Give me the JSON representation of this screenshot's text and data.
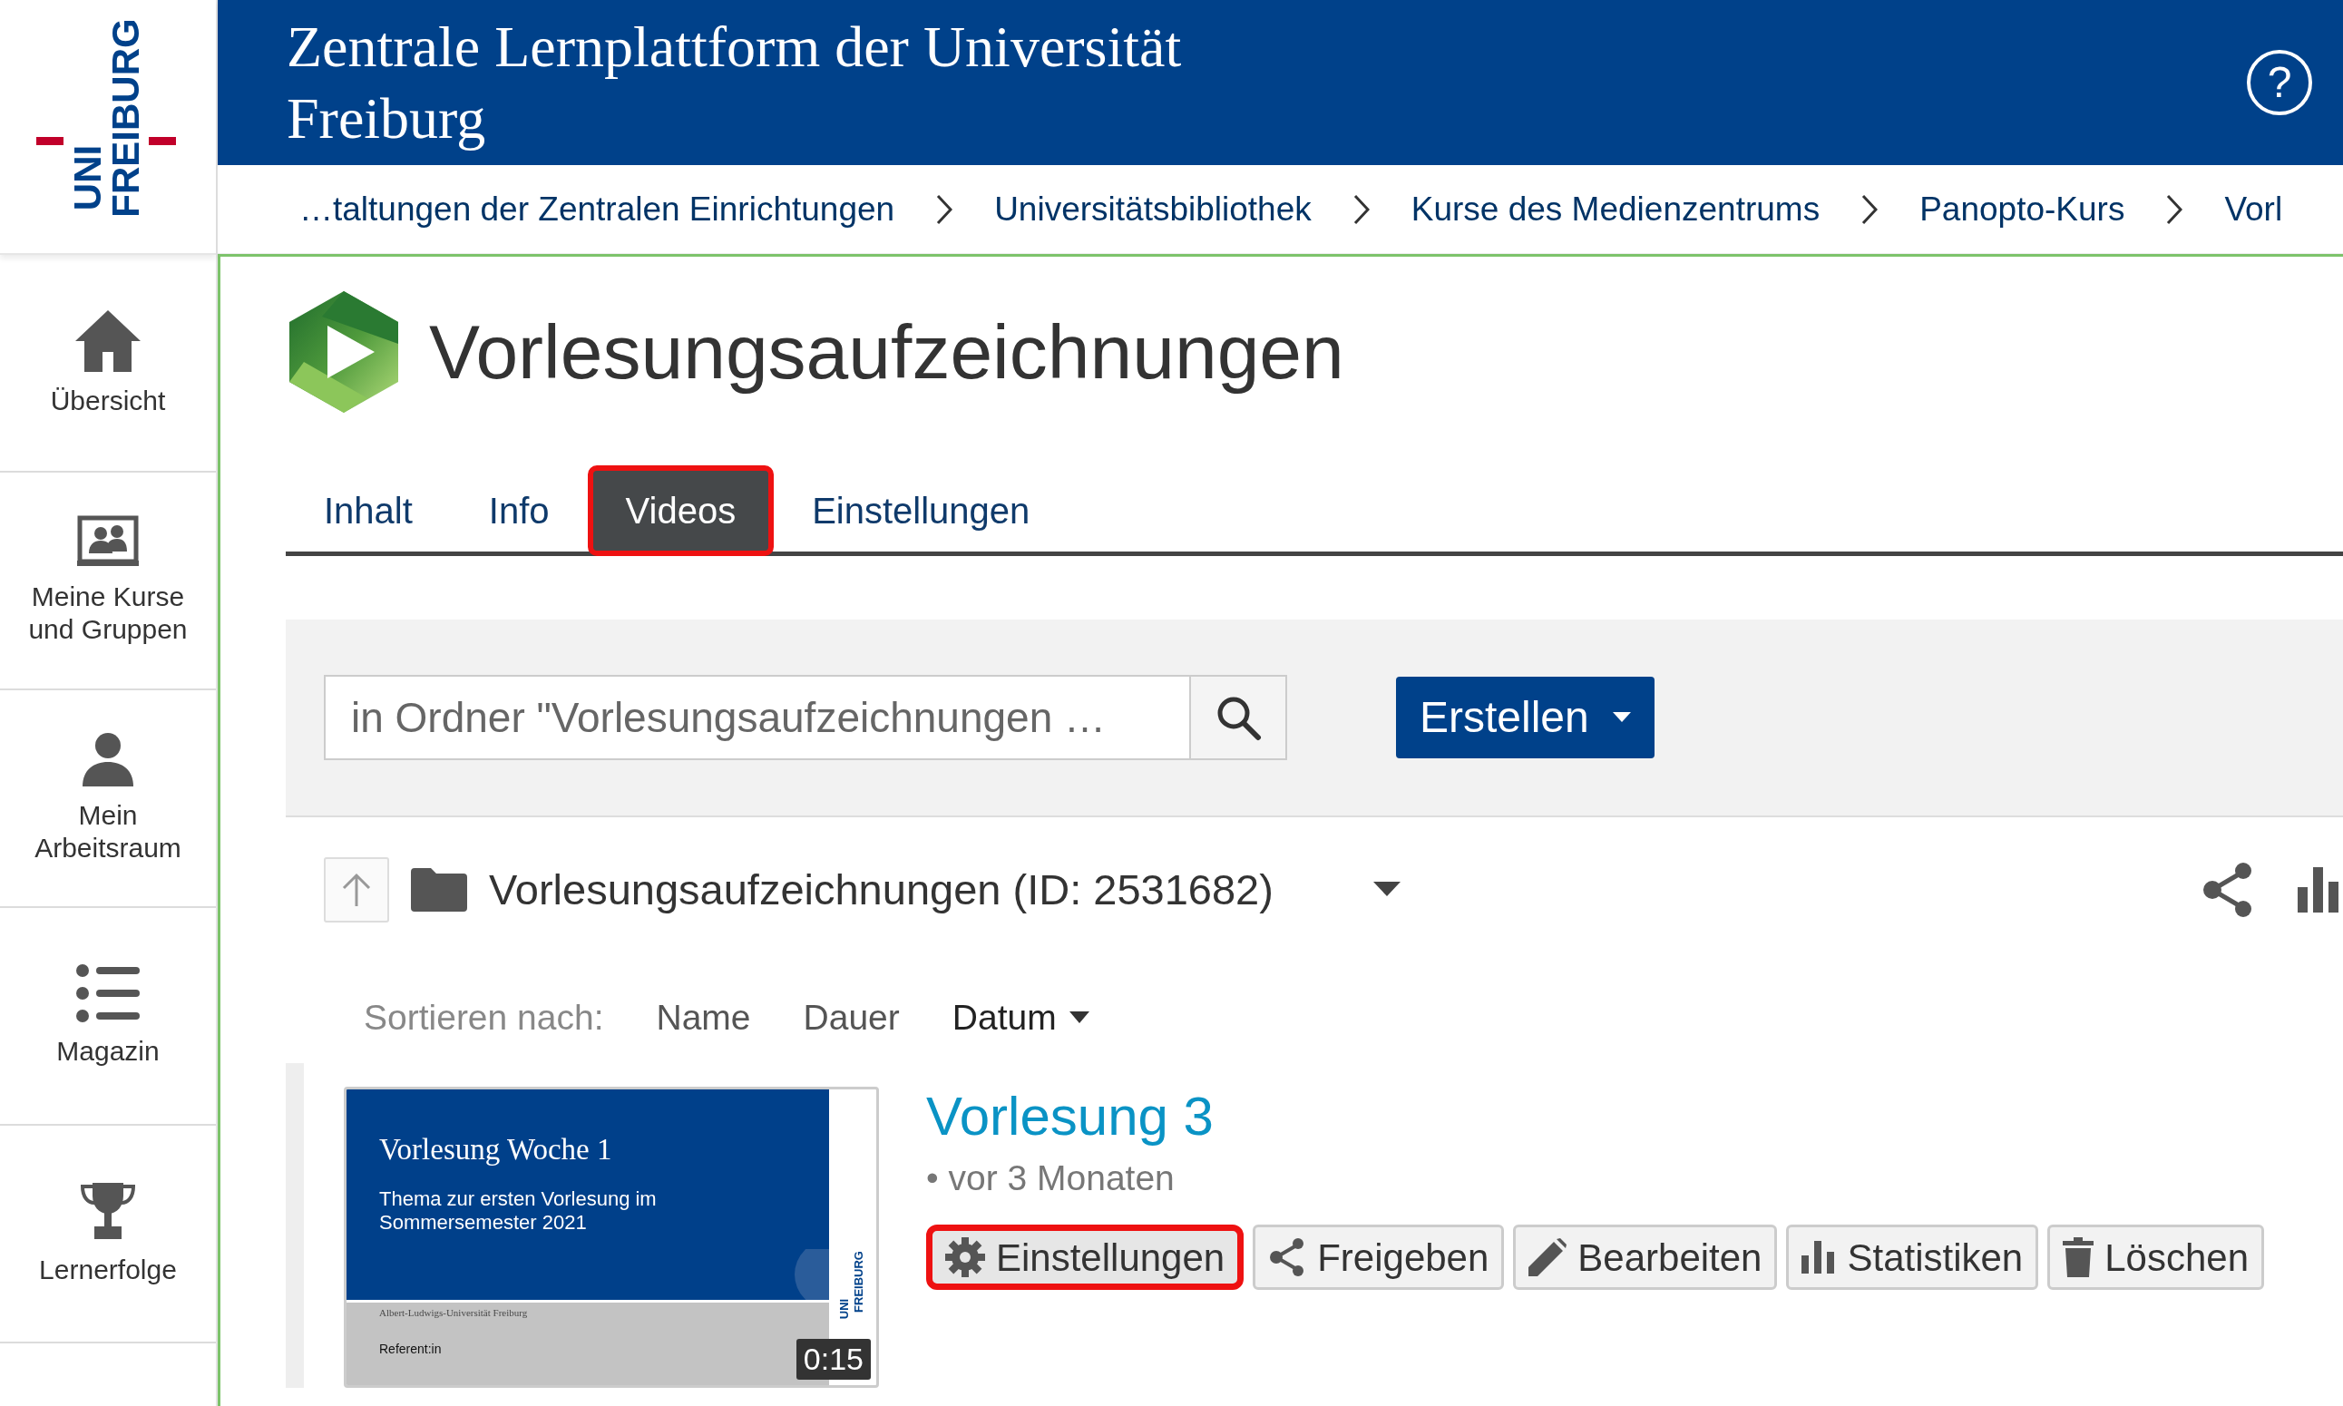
{
  "logo": {
    "line_1": "UNI",
    "line_2": "FREIBURG"
  },
  "header": {
    "title": "Zentrale Lernplattform der Universität Freiburg",
    "help": "?"
  },
  "breadcrumb": [
    "…taltungen der Zentralen Einrichtungen",
    "Universitätsbibliothek",
    "Kurse des Medienzentrums",
    "Panopto-Kurs",
    "Vorl"
  ],
  "sidebar": {
    "items": [
      {
        "label": "Übersicht"
      },
      {
        "label": "Meine Kurse und Gruppen"
      },
      {
        "label": "Mein Arbeitsraum"
      },
      {
        "label": "Magazin"
      },
      {
        "label": "Lernerfolge"
      }
    ]
  },
  "course": {
    "title": "Vorlesungsaufzeichnungen"
  },
  "tabs": [
    {
      "label": "Inhalt",
      "selected": false,
      "highlighted": false
    },
    {
      "label": "Info",
      "selected": false,
      "highlighted": false
    },
    {
      "label": "Videos",
      "selected": true,
      "highlighted": true
    },
    {
      "label": "Einstellungen",
      "selected": false,
      "highlighted": false
    }
  ],
  "panopto": {
    "search": {
      "placeholder": "in Ordner \"Vorlesungsaufzeichnungen …"
    },
    "create_button": "Erstellen",
    "folder": {
      "name": "Vorlesungsaufzeichnungen (ID: 2531682)"
    },
    "sort": {
      "label": "Sortieren nach:",
      "options": [
        {
          "label": "Name",
          "selected": false
        },
        {
          "label": "Dauer",
          "selected": false
        },
        {
          "label": "Datum",
          "selected": true
        }
      ]
    },
    "sessions": [
      {
        "title": "Vorlesung 3",
        "age": "• vor 3 Monaten",
        "duration": "0:15",
        "thumbnail": {
          "title": "Vorlesung Woche 1",
          "subtitle": "Thema zur ersten Vorlesung im Sommersemester 2021",
          "institution": "Albert-Ludwigs-Universität Freiburg",
          "speaker": "Referent:in",
          "logo_1": "UNI",
          "logo_2": "FREIBURG"
        },
        "actions": [
          {
            "label": "Einstellungen",
            "highlighted": true
          },
          {
            "label": "Freigeben",
            "highlighted": false
          },
          {
            "label": "Bearbeiten",
            "highlighted": false
          },
          {
            "label": "Statistiken",
            "highlighted": false
          },
          {
            "label": "Löschen",
            "highlighted": false
          }
        ]
      }
    ]
  }
}
